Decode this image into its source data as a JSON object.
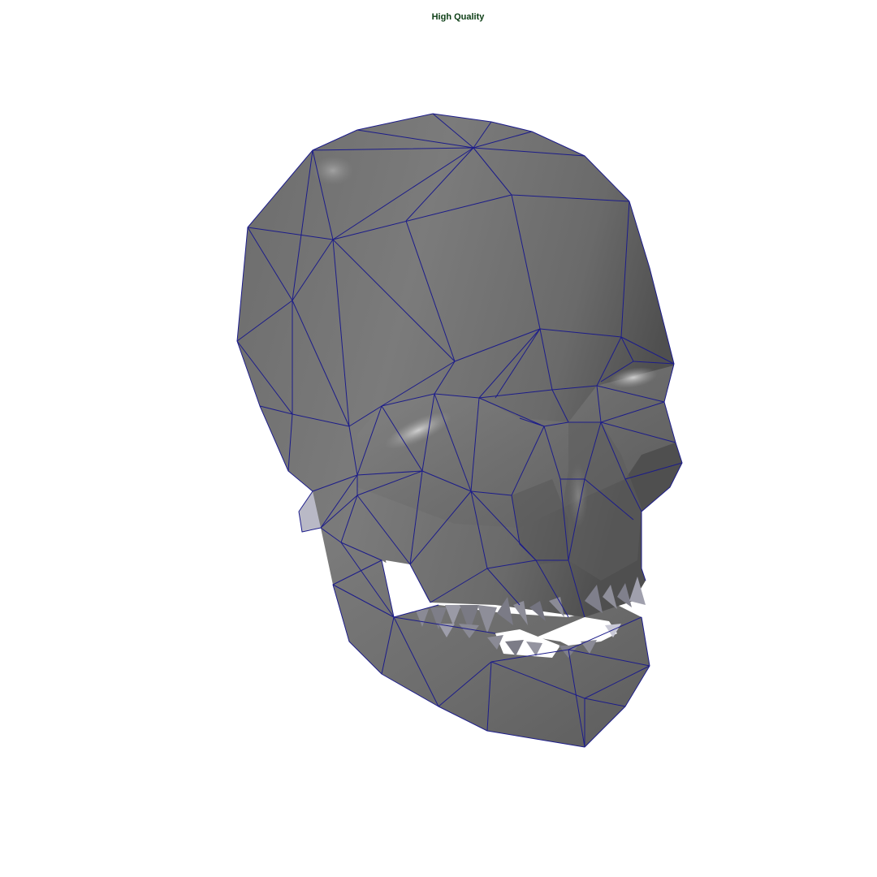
{
  "viewport": {
    "render_mode_label": "High Quality"
  },
  "model": {
    "object": "skull",
    "shading": "smooth-shaded",
    "wireframe_on_shaded": true,
    "colors": {
      "background": "#ffffff",
      "surface": "#7a7a7a",
      "surface_dark": "#5a5a5a",
      "surface_light": "#a8a8a8",
      "wireframe": "#1c1c8a",
      "label": "#0b3d14"
    }
  }
}
